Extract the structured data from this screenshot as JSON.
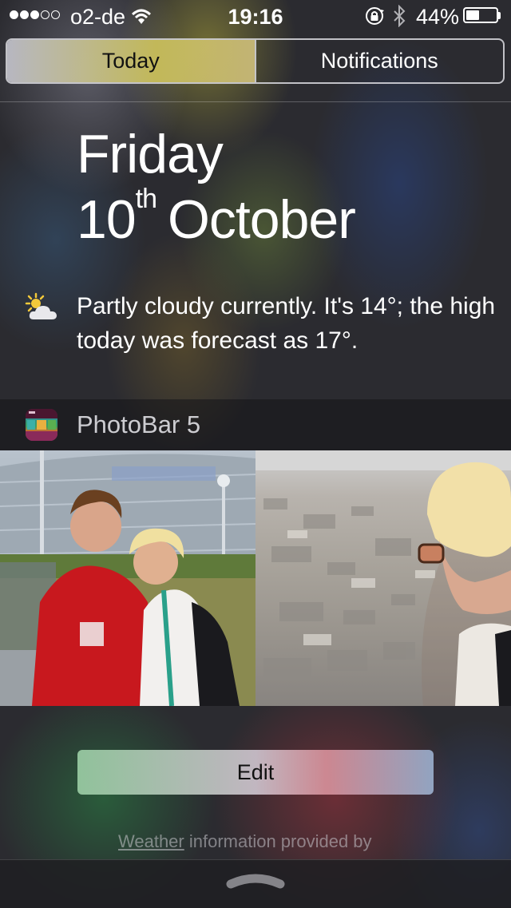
{
  "status_bar": {
    "signal_dots_filled": 3,
    "signal_dots_total": 5,
    "carrier": "o2-de",
    "time": "19:16",
    "battery_percent_label": "44%",
    "battery_level": 0.44,
    "icons": [
      "wifi-icon",
      "rotation-lock-icon",
      "bluetooth-icon",
      "battery-icon"
    ]
  },
  "tabs": {
    "today": "Today",
    "notifications": "Notifications",
    "selected": "Today"
  },
  "date": {
    "weekday": "Friday",
    "day": "10",
    "day_suffix": "th",
    "month": "October"
  },
  "weather": {
    "icon": "partly-cloudy-icon",
    "summary": "Partly cloudy currently. It's 14°; the high today was forecast as 17°."
  },
  "widget": {
    "app_name": "PhotoBar 5",
    "app_icon": "photobar-app-icon"
  },
  "edit_label": "Edit",
  "attribution": {
    "link": "Weather",
    "text": " information provided by"
  },
  "colors": {
    "accent_today_tab": "#c8be5a",
    "background": "#2b2b30"
  }
}
